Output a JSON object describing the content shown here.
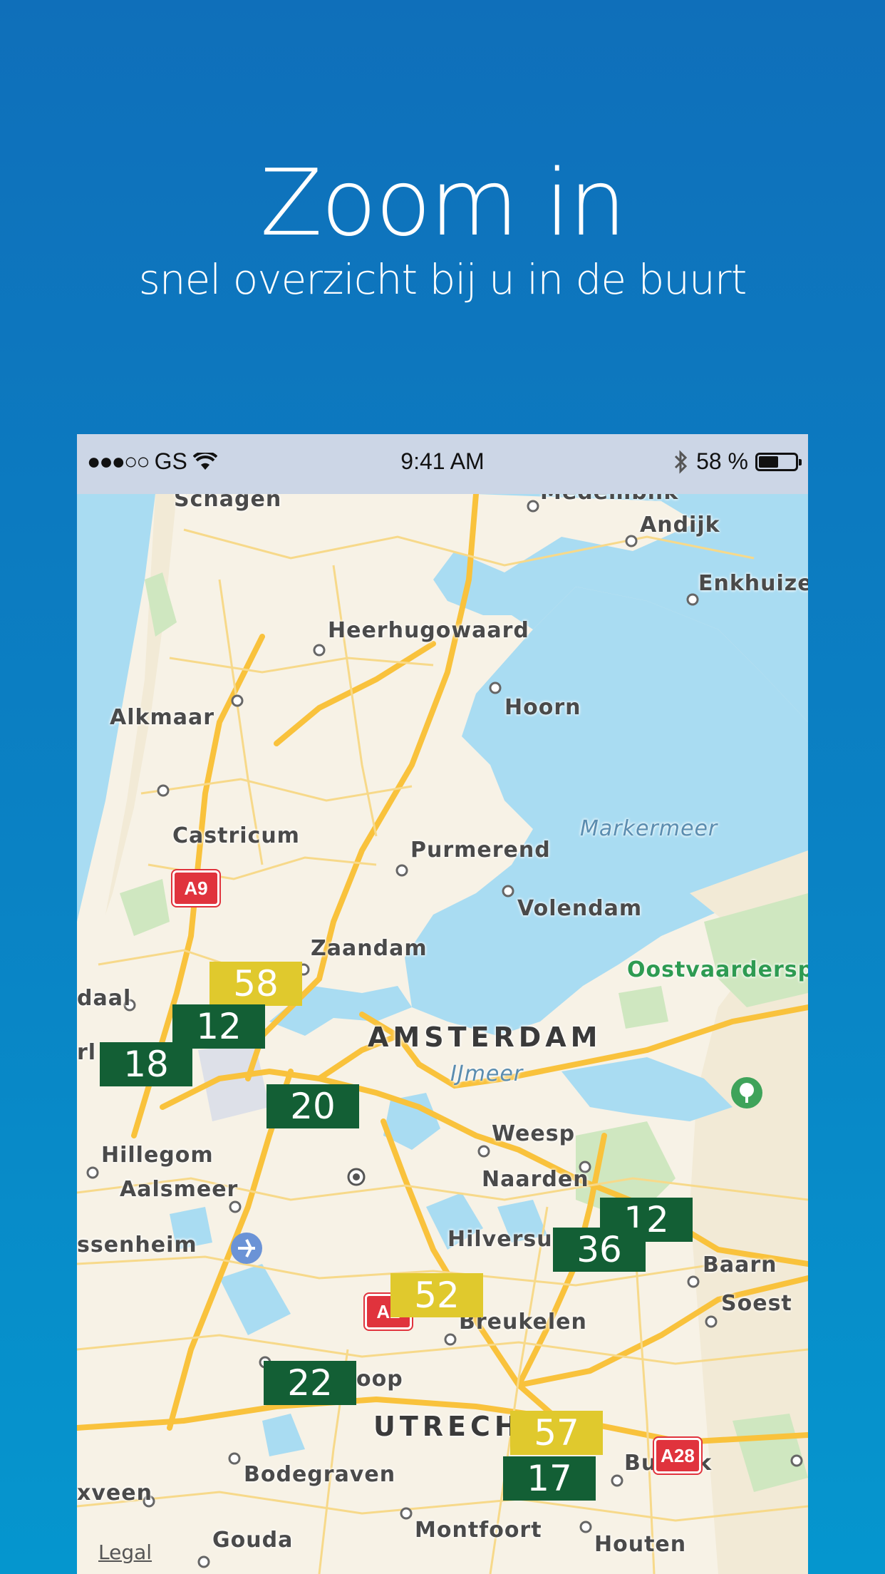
{
  "hero": {
    "title": "Zoom in",
    "subtitle": "snel overzicht bij u in de buurt"
  },
  "statusbar": {
    "signal": "●●●○○",
    "carrier": "GS",
    "time": "9:41 AM",
    "battery_text": "58 %",
    "battery_level": 0.58,
    "icons": [
      "wifi-icon",
      "bluetooth-icon",
      "battery-icon"
    ]
  },
  "map": {
    "places": {
      "schagen": "Schagen",
      "medemblik": "Medemblik",
      "andijk": "Andijk",
      "enkhuizen": "Enkhuizen",
      "heerhugowaard": "Heerhugowaard",
      "alkmaar": "Alkmaar",
      "hoorn": "Hoorn",
      "castricum": "Castricum",
      "purmerend": "Purmerend",
      "volendam": "Volendam",
      "zaandam": "Zaandam",
      "haarlem_partial": "daal",
      "haarlem_l": "rl",
      "amsterdam": "AMSTERDAM",
      "weesp": "Weesp",
      "hillegom": "Hillegom",
      "aalsmeer": "Aalsmeer",
      "naarden": "Naarden",
      "sassenheim": "ssenheim",
      "hilversum": "Hilversu",
      "baarn": "Baarn",
      "soest": "Soest",
      "breukelen": "Breukelen",
      "woerden_partial": "oop",
      "utrecht": "UTRECH",
      "bunnik": "Bunnik",
      "bodegraven": "Bodegraven",
      "alphen": "xveen",
      "gouda": "Gouda",
      "montfoort": "Montfoort",
      "houten": "Houten"
    },
    "water": {
      "markermeer": "Markermeer",
      "ijmeer": "IJmeer"
    },
    "park": "Oostvaardersplassen",
    "road_signs": [
      "A9",
      "A2",
      "A28"
    ],
    "markers": [
      {
        "value": "58",
        "level": "yellow"
      },
      {
        "value": "12",
        "level": "green"
      },
      {
        "value": "18",
        "level": "green"
      },
      {
        "value": "20",
        "level": "green"
      },
      {
        "value": "12",
        "level": "green"
      },
      {
        "value": "36",
        "level": "green"
      },
      {
        "value": "52",
        "level": "yellow"
      },
      {
        "value": "22",
        "level": "green"
      },
      {
        "value": "57",
        "level": "yellow"
      },
      {
        "value": "17",
        "level": "green"
      }
    ],
    "legal": "Legal",
    "colors": {
      "good": "#135f35",
      "moderate": "#e0c92d",
      "water": "#a9dcf2",
      "land": "#f7f2e6",
      "road": "#f9c23c",
      "sign": "#e0333d"
    }
  }
}
